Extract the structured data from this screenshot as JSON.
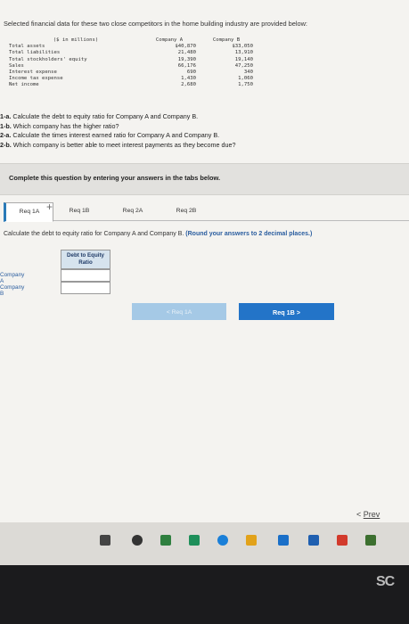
{
  "intro": "Selected financial data for these two close competitors in the home building industry are provided below:",
  "financials": {
    "header_label": "($ in millions)",
    "header_a": "Company A",
    "header_b": "Company B",
    "rows": [
      {
        "label": "Total assets",
        "a": "$40,870",
        "b": "$33,050"
      },
      {
        "label": "Total liabilities",
        "a": "21,480",
        "b": "13,910"
      },
      {
        "label": "Total stockholders' equity",
        "a": "19,390",
        "b": "19,140"
      },
      {
        "label": "Sales",
        "a": "66,176",
        "b": "47,250"
      },
      {
        "label": "Interest expense",
        "a": "690",
        "b": "340"
      },
      {
        "label": "Income tax expense",
        "a": "1,430",
        "b": "1,060"
      },
      {
        "label": "Net income",
        "a": "2,680",
        "b": "1,750"
      }
    ]
  },
  "questions": [
    {
      "num": "1-a.",
      "text": " Calculate the debt to equity ratio for Company A and Company B."
    },
    {
      "num": "1-b.",
      "text": " Which company has the higher ratio?"
    },
    {
      "num": "2-a.",
      "text": " Calculate the times interest earned ratio for Company A and Company B."
    },
    {
      "num": "2-b.",
      "text": " Which company is better able to meet interest payments as they become due?"
    }
  ],
  "complete_text": "Complete this question by entering your answers in the tabs below.",
  "tabs": [
    "Req 1A",
    "Req 1B",
    "Req 2A",
    "Req 2B"
  ],
  "instruction_main": "Calculate the debt to equity ratio for Company A and Company B.",
  "instruction_note": " (Round your answers to 2 decimal places.)",
  "answer_table": {
    "header": "Debt to Equity Ratio",
    "rows": [
      "Company A",
      "Company B"
    ],
    "values": [
      "",
      ""
    ]
  },
  "nav": {
    "prev": "< Req 1A",
    "next": "Req 1B  >"
  },
  "prev_link": {
    "arrow": "<",
    "text": "Prev"
  },
  "brand": "SC"
}
